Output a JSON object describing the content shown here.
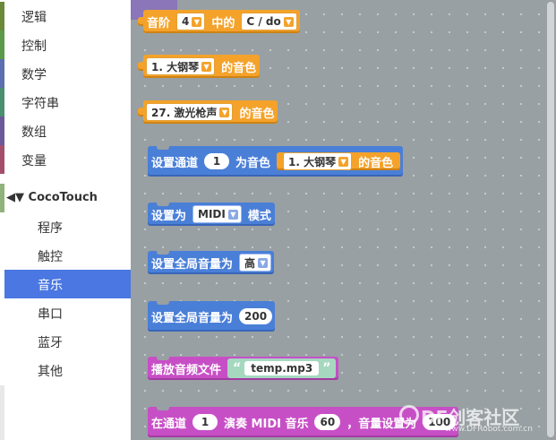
{
  "toolbox": {
    "categories": [
      {
        "label": "逻辑",
        "color": "#6a8a3a"
      },
      {
        "label": "控制",
        "color": "#5b9a48"
      },
      {
        "label": "数学",
        "color": "#5d6fb0"
      },
      {
        "label": "字符串",
        "color": "#4a9070"
      },
      {
        "label": "数组",
        "color": "#6a5a9a"
      },
      {
        "label": "变量",
        "color": "#a34f6c"
      }
    ],
    "group": {
      "arrows": "◀▼",
      "label": "CocoTouch"
    },
    "subcategories": [
      {
        "label": "程序"
      },
      {
        "label": "触控"
      },
      {
        "label": "音乐",
        "selected": true
      },
      {
        "label": "串口"
      },
      {
        "label": "蓝牙"
      },
      {
        "label": "其他"
      }
    ]
  },
  "blocks": {
    "scale_note": {
      "t1": "音阶",
      "octave": "4",
      "t2": "中的",
      "note": "C / do"
    },
    "instrument_1": {
      "value": "1. 大钢琴",
      "t1": "的音色"
    },
    "instrument_27": {
      "value": "27. 激光枪声",
      "t1": "的音色"
    },
    "set_channel": {
      "t1": "设置通道",
      "channel": "1",
      "t2": "为音色",
      "instrument": "1. 大钢琴",
      "t3": "的音色"
    },
    "set_mode": {
      "t1": "设置为",
      "mode": "MIDI",
      "t2": "模式"
    },
    "set_volume_level": {
      "t1": "设置全局音量为",
      "level": "高"
    },
    "set_volume_value": {
      "t1": "设置全局音量为",
      "value": "200"
    },
    "play_file": {
      "t1": "播放音频文件",
      "q_open": "“",
      "file": "temp.mp3",
      "q_close": "”"
    },
    "play_midi": {
      "t1": "在通道",
      "channel": "1",
      "t2": "演奏 MIDI 音乐",
      "note": "60",
      "t3": "，音量设置为",
      "volume": "100"
    }
  },
  "colors": {
    "control_orange": "#f4a22a",
    "action_blue": "#4a7fd8",
    "sound_pink": "#c74fc6",
    "workspace": "#98a0a3",
    "selected": "#4a77e2"
  },
  "watermark": {
    "text": "DF创客社区",
    "url": "www.DFRobot.com.cn"
  }
}
